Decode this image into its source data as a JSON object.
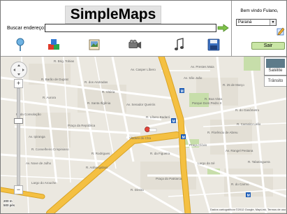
{
  "header": {
    "title": "SimpleMaps",
    "search_label": "Buscar endereço:",
    "search_value": "",
    "tools": [
      "map-pin-icon",
      "layers-cubes-icon",
      "gallery-icon",
      "video-camera-icon",
      "music-note-icon",
      "save-disk-icon"
    ]
  },
  "user_panel": {
    "welcome": "Bem vindo Fulano,",
    "state_selected": "Paraná",
    "exit_label": "Sair"
  },
  "map": {
    "satellite_label": "Satélite",
    "traffic_label": "Trânsito",
    "scale_top": "200 m",
    "scale_bottom": "500 pés",
    "attribution": "Dados cartográficos ©2012 Google, MapLink, Termos de uso",
    "street_labels": [
      "R. Brig. Tobias",
      "Av. Casper Líbero",
      "Av. Prestes Maia",
      "R. Barão de Duprat",
      "R. dos Andradas",
      "R. Vitória",
      "R. Aurora",
      "Av. São João",
      "R. 25 de Março",
      "R. Boa Vista",
      "Av. Senador Queirós",
      "R. do Gasômetro",
      "Parque Dom Pedro II",
      "R. Carneiro Leão",
      "Largo da Sé",
      "Praça Clóvis",
      "R. Florêncio de Abreu",
      "R. da Consolação",
      "Av. Ipiranga",
      "R. Conselheiro Crispiniano",
      "R. Líbero Badaró",
      "Viaduto do Chá",
      "Av. Rangel Pestana",
      "Praça da República",
      "R. Rodrigues",
      "Av. Nove de Julho",
      "R. da Figueira",
      "R. Anhangabaú",
      "Praça do Patriarca",
      "R. Direita",
      "R. Santa Ifigênia",
      "Largo do Arouche",
      "R. do Carmo",
      "R. Tabatinguera"
    ]
  },
  "colors": {
    "highway": "#f4c042",
    "highway_edge": "#d9a324",
    "street": "#ffffff",
    "land": "#ebe8e0",
    "block": "#e3dfd5",
    "park": "#c7deaa",
    "accent_green": "#c9e6a5"
  }
}
